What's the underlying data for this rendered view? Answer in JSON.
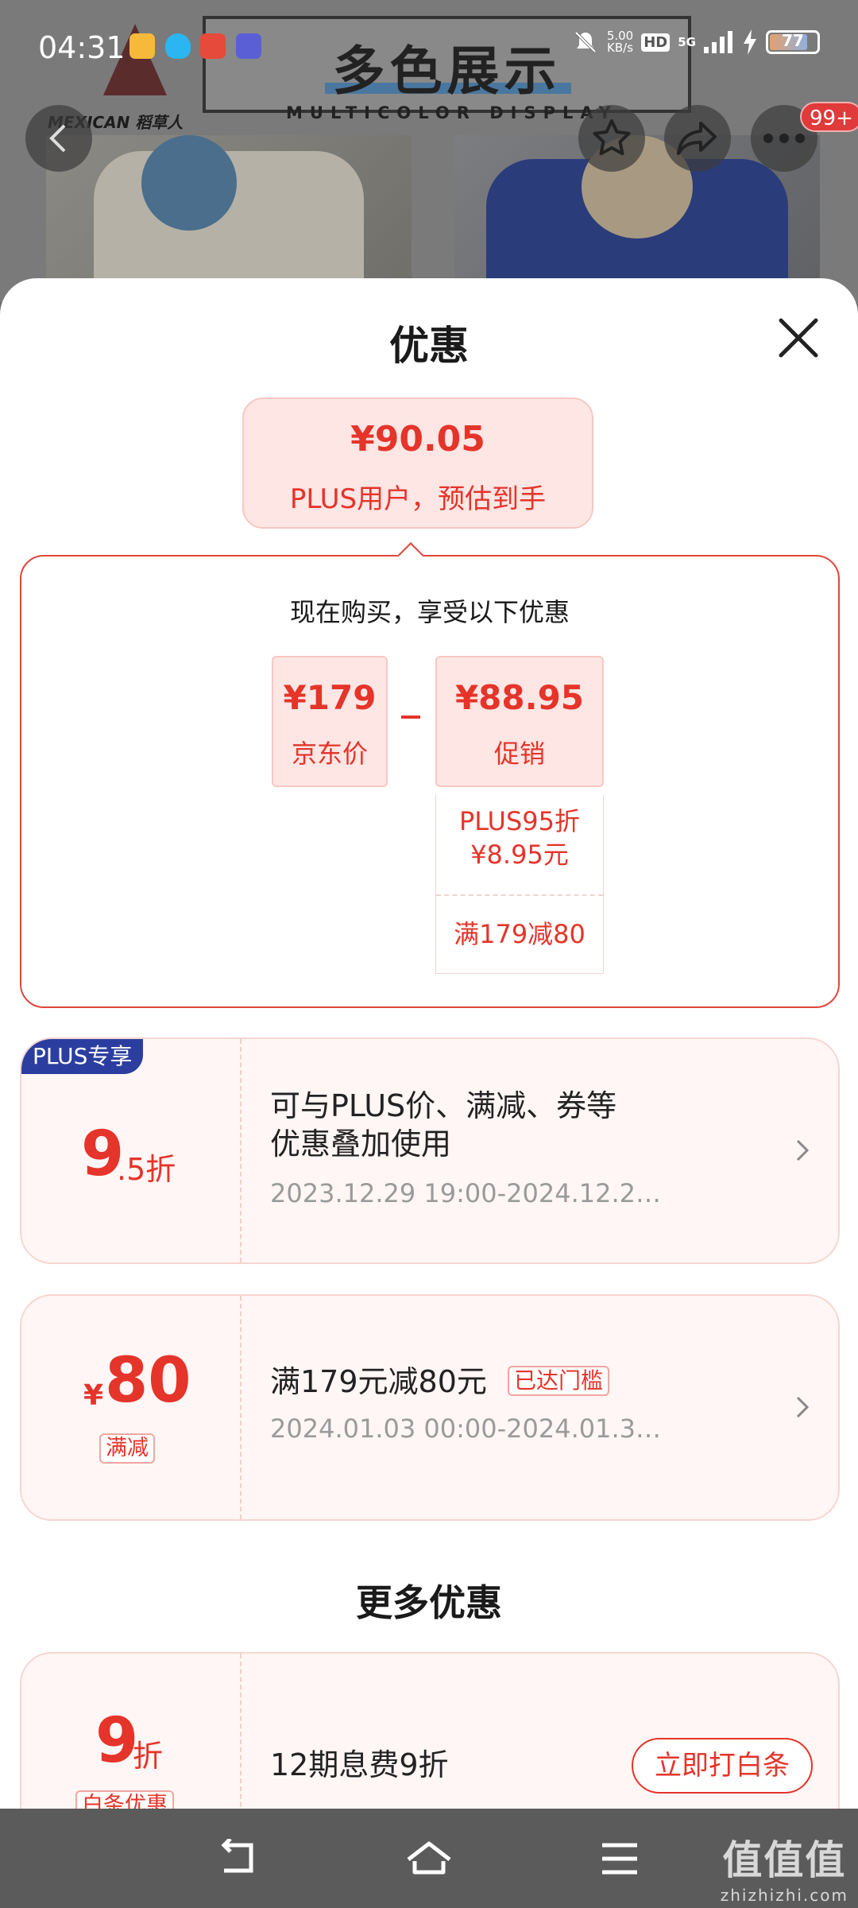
{
  "status_bar": {
    "time": "04:31",
    "net_speed_value": "5.00",
    "net_speed_unit": "KB/s",
    "hd": "HD",
    "network": "5G",
    "battery": "77"
  },
  "banner": {
    "title": "多色展示",
    "subtitle": "MULTICOLOR DISPLAY",
    "brand": "MEXICAN 稻草人"
  },
  "header": {
    "notification_badge": "99+"
  },
  "sheet": {
    "title": "优惠",
    "estimate": {
      "price": "¥90.05",
      "label": "PLUS用户，预估到手"
    },
    "calculation": {
      "heading": "现在购买，享受以下优惠",
      "base_price": "¥179",
      "base_label": "京东价",
      "discount_price": "¥88.95",
      "discount_label": "促销",
      "promo_items": [
        "PLUS95折",
        "¥8.95元",
        "满179减80"
      ]
    },
    "coupons": [
      {
        "tag": "PLUS专享",
        "value_main": "9",
        "value_suffix": ".5折",
        "title_line1": "可与PLUS价、满减、券等",
        "title_line2": "优惠叠加使用",
        "date": "2023.12.29 19:00-2024.12.2…"
      },
      {
        "currency": "¥",
        "value_main": "80",
        "type_tag": "满减",
        "title": "满179元减80元",
        "status_tag": "已达门槛",
        "date": "2024.01.03 00:00-2024.01.3…"
      }
    ],
    "more_title": "更多优惠",
    "more_offers": [
      {
        "value_main": "9",
        "value_suffix": "折",
        "type_tag": "白条优惠",
        "title": "12期息费9折",
        "button": "立即打白条"
      }
    ]
  },
  "watermark": {
    "text": "值值值",
    "site": "zhizhizhi.com"
  }
}
